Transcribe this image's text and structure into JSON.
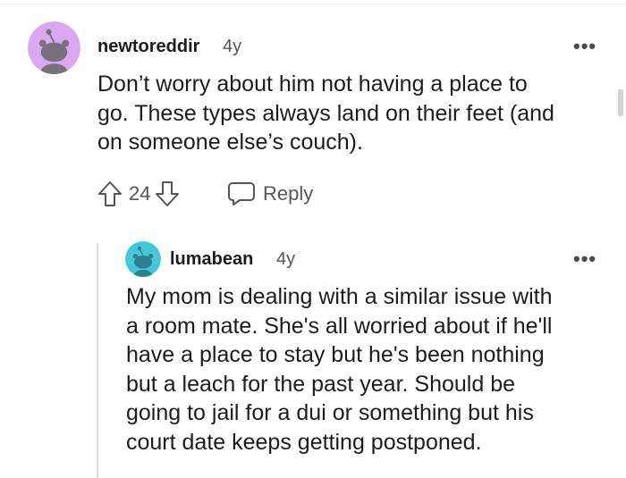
{
  "comment": {
    "username": "newtoreddir",
    "age": "4y",
    "more_label": "•••",
    "lines": [
      "Don’t worry about him not having a place to",
      "go. These types always land on their feet (and",
      "on someone else’s couch)."
    ],
    "score": "24",
    "reply_label": "Reply",
    "avatar_color": "#d9a8f0"
  },
  "reply": {
    "username": "lumabean",
    "age": "4y",
    "more_label": "•••",
    "lines": [
      "My mom is dealing with a similar issue with",
      "a room mate. She's all worried about if he'll",
      "have a place to stay but he's been nothing",
      "but a leach for the past year. Should be",
      "going to jail for a dui or something but his",
      "court date keeps getting postponed."
    ],
    "avatar_color": "#44c8d8"
  }
}
